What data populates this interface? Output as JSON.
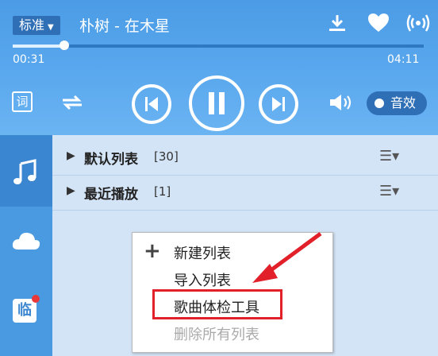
{
  "player": {
    "quality": "标准",
    "song_title": "朴树 - 在木星",
    "time_current": "00:31",
    "time_total": "04:11",
    "progress": 0.125,
    "lyric_label": "词",
    "effect_label": "音效"
  },
  "icons": {
    "download": "download-icon",
    "favorite": "heart-icon",
    "broadcast": "broadcast-icon",
    "repeat": "repeat-icon",
    "prev": "previous-icon",
    "pause": "pause-icon",
    "next": "next-icon",
    "volume": "volume-icon",
    "music": "music-note-icon",
    "cloud": "cloud-icon",
    "temp": "temp-list-icon"
  },
  "sidebar": {
    "temp_label": "临"
  },
  "playlists": [
    {
      "name": "默认列表",
      "count": "[30]"
    },
    {
      "name": "最近播放",
      "count": "[1]"
    }
  ],
  "context_menu": {
    "items": [
      "新建列表",
      "导入列表",
      "歌曲体检工具",
      "删除所有列表"
    ]
  },
  "colors": {
    "highlight": "#e2202a",
    "accent": "#4b9ce6"
  }
}
